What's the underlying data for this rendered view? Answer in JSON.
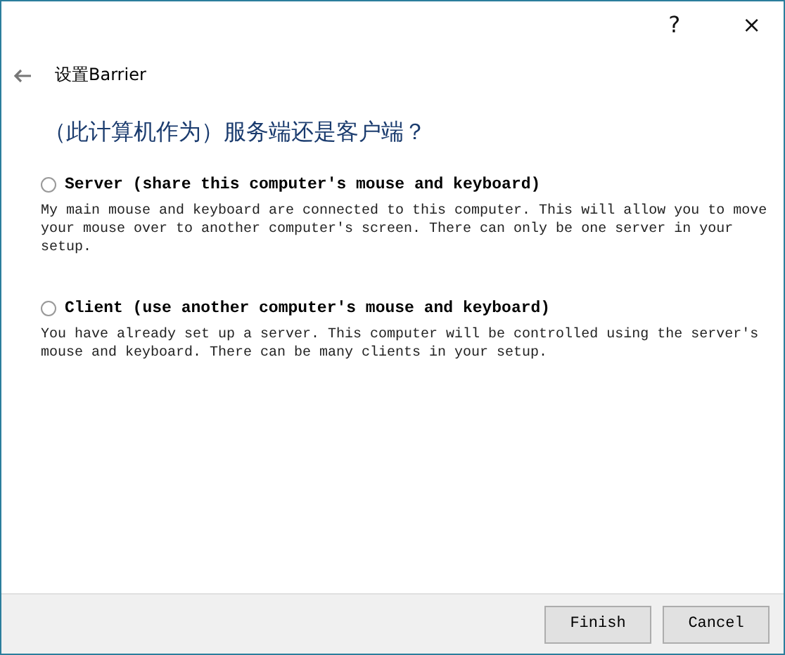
{
  "title_bar": {
    "help": "?",
    "close": "×"
  },
  "page": {
    "title": "设置Barrier",
    "heading": "（此计算机作为）服务端还是客户端？"
  },
  "options": [
    {
      "label": "Server (share this computer's mouse and keyboard)",
      "selected": false,
      "description": "My main mouse and keyboard are connected to this computer. This will allow you to move your mouse over to another computer's screen. There can only be one server in your setup."
    },
    {
      "label": "Client (use another computer's mouse and keyboard)",
      "selected": false,
      "description": "You have already set up a server. This computer will be controlled using the server's mouse and keyboard. There can be many clients in your setup."
    }
  ],
  "buttons": [
    "Finish",
    "Cancel"
  ]
}
